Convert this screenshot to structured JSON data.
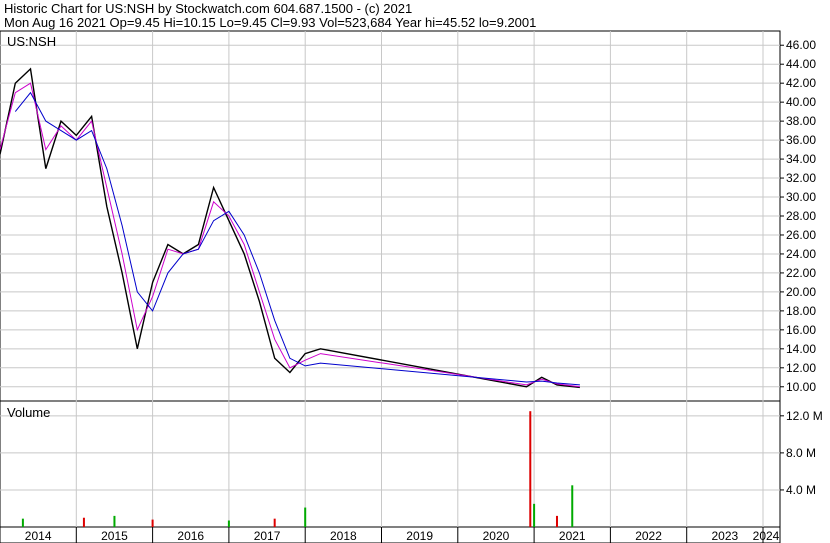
{
  "header": {
    "line1": "Historic Chart for US:NSH by Stockwatch.com 604.687.1500 - (c) 2021",
    "line2": "Mon Aug 16 2021   Op=9.45   Hi=10.15   Lo=9.45   Cl=9.93   Vol=523,684   Year hi=45.52   lo=9.2001"
  },
  "colors": {
    "price": "#000000",
    "ma_short": "#cc00cc",
    "ma_long": "#0000cc",
    "volume_up": "#00aa00",
    "volume_down": "#dd0000",
    "grid": "#c8c8c8"
  },
  "chart_data": [
    {
      "type": "line",
      "title": "US:NSH",
      "y_axis_side": "right",
      "ylim": [
        8.5,
        47.5
      ],
      "yticks": [
        "46.00",
        "44.00",
        "42.00",
        "40.00",
        "38.00",
        "36.00",
        "34.00",
        "32.00",
        "30.00",
        "28.00",
        "26.00",
        "24.00",
        "22.00",
        "20.00",
        "18.00",
        "16.00",
        "14.00",
        "12.00",
        "10.00"
      ],
      "x_labels": [
        "2014",
        "2015",
        "2016",
        "2017",
        "2018",
        "2019",
        "2020",
        "2021",
        "2022",
        "2023",
        "2024"
      ],
      "x": [
        "2014.0",
        "2014.2",
        "2014.4",
        "2014.6",
        "2014.8",
        "2015.0",
        "2015.2",
        "2015.4",
        "2015.6",
        "2015.8",
        "2016.0",
        "2016.2",
        "2016.4",
        "2016.6",
        "2016.8",
        "2017.0",
        "2017.2",
        "2017.4",
        "2017.6",
        "2017.8",
        "2018.0",
        "2018.2",
        "2020.9",
        "2021.1",
        "2021.3",
        "2021.6"
      ],
      "series": [
        {
          "values": [
            34.5,
            42,
            43.5,
            33,
            38,
            36.5,
            38.5,
            29,
            22,
            14,
            21,
            25,
            24,
            25,
            31,
            27.5,
            24,
            19,
            13,
            11.5,
            13.5,
            14,
            10,
            11,
            10.2,
            9.93
          ]
        },
        {
          "values": [
            35,
            41,
            42,
            35,
            37.5,
            36,
            38,
            31,
            24,
            16,
            19.5,
            24.5,
            24,
            24.5,
            29.5,
            28,
            25,
            20,
            15,
            12,
            12.8,
            13.5,
            10.2,
            10.8,
            10.3,
            10.0
          ]
        },
        {
          "values": [
            null,
            39,
            41,
            38,
            37,
            36,
            37,
            33,
            27,
            20,
            18,
            22,
            24,
            24.5,
            27.5,
            28.5,
            26,
            22,
            17,
            13,
            12.2,
            12.5,
            10.5,
            10.6,
            10.4,
            10.2
          ]
        }
      ]
    },
    {
      "type": "bar",
      "title": "Volume",
      "y_axis_side": "right",
      "ylim": [
        0,
        13600000
      ],
      "yticks": [
        "12.0 M",
        "8.0 M",
        "4.0 M"
      ],
      "x": [
        "2014.3",
        "2015.1",
        "2015.5",
        "2016.0",
        "2017.0",
        "2017.6",
        "2018.0",
        "2020.95",
        "2021.0",
        "2021.3",
        "2021.5"
      ],
      "values": [
        900000,
        1000000,
        1200000,
        800000,
        700000,
        900000,
        2100000,
        12500000,
        2500000,
        1200000,
        4500000
      ]
    }
  ]
}
